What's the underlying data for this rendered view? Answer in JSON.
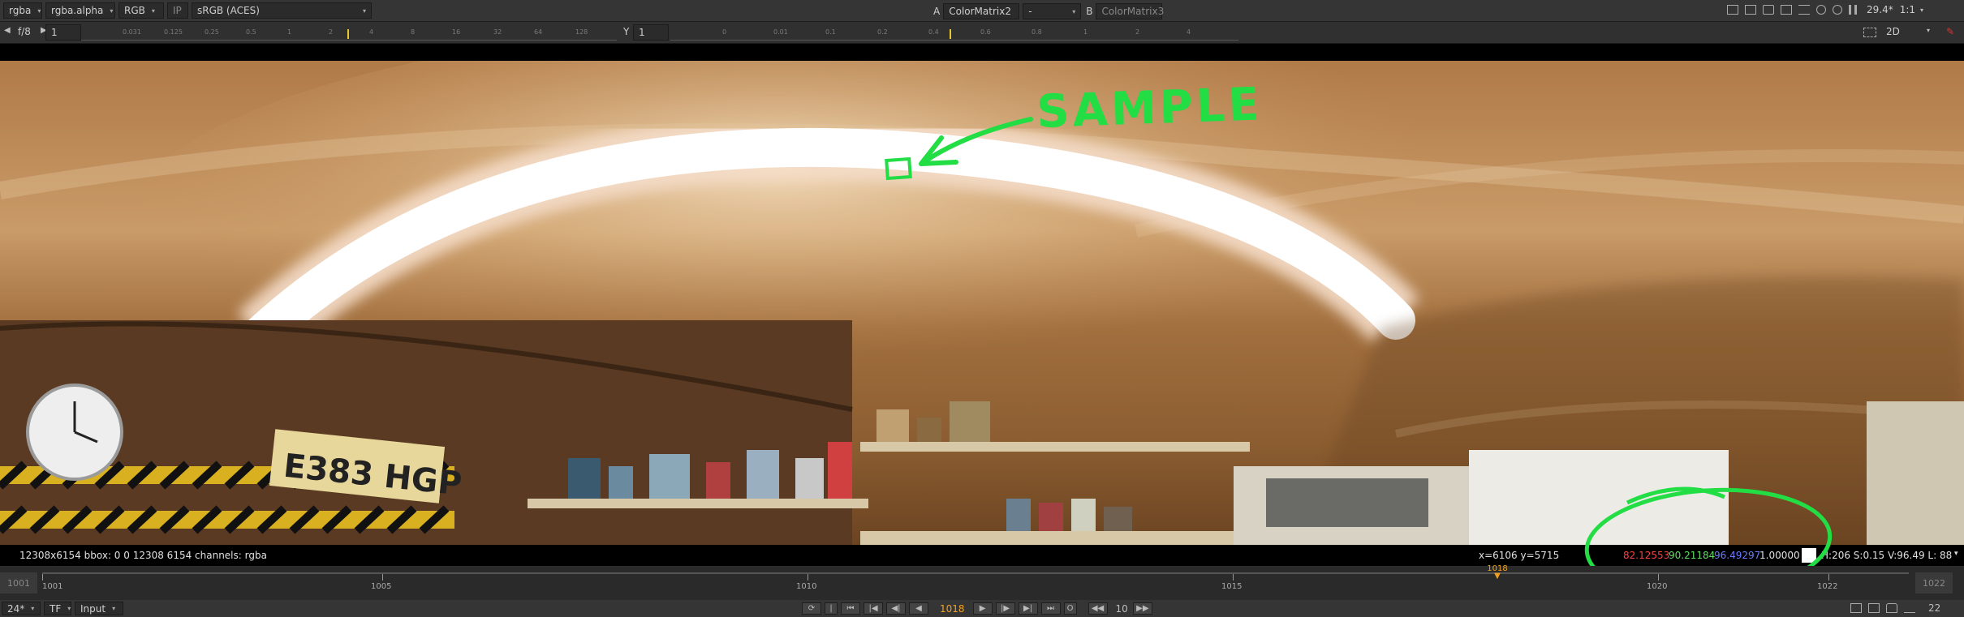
{
  "topbar": {
    "channels": "rgba",
    "alpha_channel": "rgba.alpha",
    "color_mode": "RGB",
    "ip_label": "IP",
    "lut": "sRGB (ACES)",
    "a_label": "A",
    "a_input": "ColorMatrix2",
    "blend_mode": "-",
    "b_label": "B",
    "b_input": "ColorMatrix3",
    "zoom": "29.4*",
    "ratio": "1:1"
  },
  "subbar": {
    "fstop": "f/8",
    "gain": "1",
    "gamma_label": "Y",
    "gamma": "1",
    "view_mode": "2D",
    "gain_ticks": [
      "0.031",
      "0.125",
      "0.25",
      "0.5",
      "1",
      "2",
      "4",
      "8",
      "16",
      "32",
      "64",
      "128"
    ],
    "gamma_ticks": [
      "0",
      "0.01",
      "0.1",
      "0.2",
      "0.4",
      "0.6",
      "0.8",
      "1",
      "2",
      "4"
    ]
  },
  "annotation": {
    "text": "SAMPLE"
  },
  "plate": {
    "text": "E383 HGP"
  },
  "status": {
    "info": "12308x6154  bbox: 0 0 12308 6154 channels: rgba",
    "coords": "x=6106 y=5715",
    "r": "82.12553",
    "g": "90.21184",
    "b": "96.49297",
    "a": "1.00000",
    "hsvl": "H:206 S:0.15 V:96.49  L: 88"
  },
  "timeline": {
    "start": "1001",
    "end": "1022",
    "current": "1018",
    "labels": [
      "1001",
      "1005",
      "1010",
      "1015",
      "1020",
      "1022"
    ]
  },
  "playback": {
    "fps": "24*",
    "tf": "TF",
    "input": "Input",
    "current_frame": "1018",
    "increment": "10",
    "end_frame": "22"
  },
  "colors": {
    "annotation_green": "#22dd44",
    "current_frame_orange": "#f0a020",
    "red_value": "#ff4040",
    "green_value": "#60e060",
    "blue_value": "#6a7bff"
  }
}
